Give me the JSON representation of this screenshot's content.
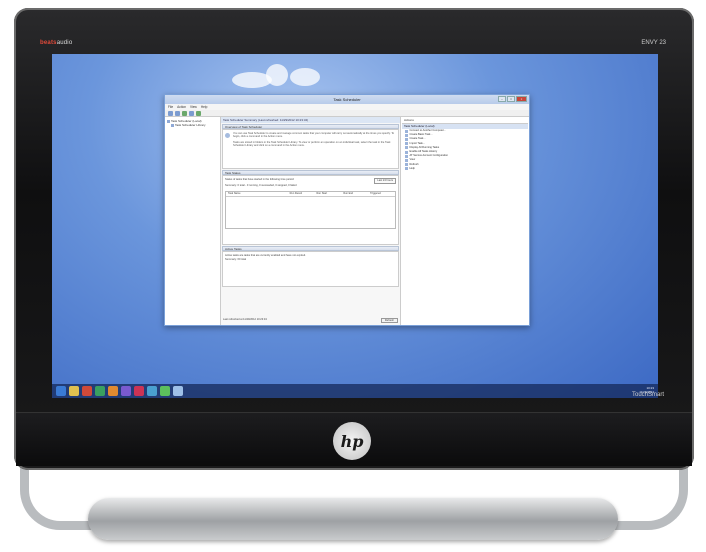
{
  "monitor": {
    "brand_left_a": "beats",
    "brand_left_b": "audio",
    "brand_right": "ENVY 23",
    "touchsmart": "TouchSmart",
    "logo_text": "hp"
  },
  "window": {
    "title": "Task Scheduler",
    "menu": [
      "File",
      "Action",
      "View",
      "Help"
    ],
    "left_tree": [
      "Task Scheduler (Local)",
      "Task Scheduler Library"
    ],
    "center_header": "Task Scheduler Summary (Last refreshed: 11/29/2012 10:23:34)",
    "overview_head": "Overview of Task Scheduler",
    "overview_text": "You can use Task Scheduler to create and manage common tasks that your computer will carry out automatically at the times you specify. To begin, click a command in the Action menu.",
    "overview_text2": "Tasks are stored in folders in the Task Scheduler Library. To view or perform an operation on an individual task, select the task in the Task Scheduler Library and click on a command in the Action menu.",
    "status_head": "Task Status",
    "status_label": "Status of tasks that have started in the following time period:",
    "status_select": "Last 24 hours",
    "summary_line": "Summary: 0 total - 0 running, 0 succeeded, 0 stopped, 0 failed",
    "table_headers": [
      "Task Name",
      "Run Result",
      "Run Start",
      "Run End",
      "Triggered"
    ],
    "active_head": "Active Tasks",
    "active_text": "Active tasks are tasks that are currently enabled and have not expired.",
    "active_summary": "Summary: 60 total",
    "last_refreshed": "Last refreshed at 11/29/2012 10:23:34",
    "refresh_label": "Refresh",
    "actions_title": "Actions",
    "actions_group": "Task Scheduler (Local)",
    "actions": [
      "Connect to Another Computer...",
      "Create Basic Task...",
      "Create Task...",
      "Import Task...",
      "Display All Running Tasks",
      "Enable All Tasks History",
      "AT Service Account Configuration",
      "View",
      "Refresh",
      "Help"
    ]
  },
  "taskbar": {
    "clock_time": "10:23",
    "clock_date": "11/29/2012"
  }
}
